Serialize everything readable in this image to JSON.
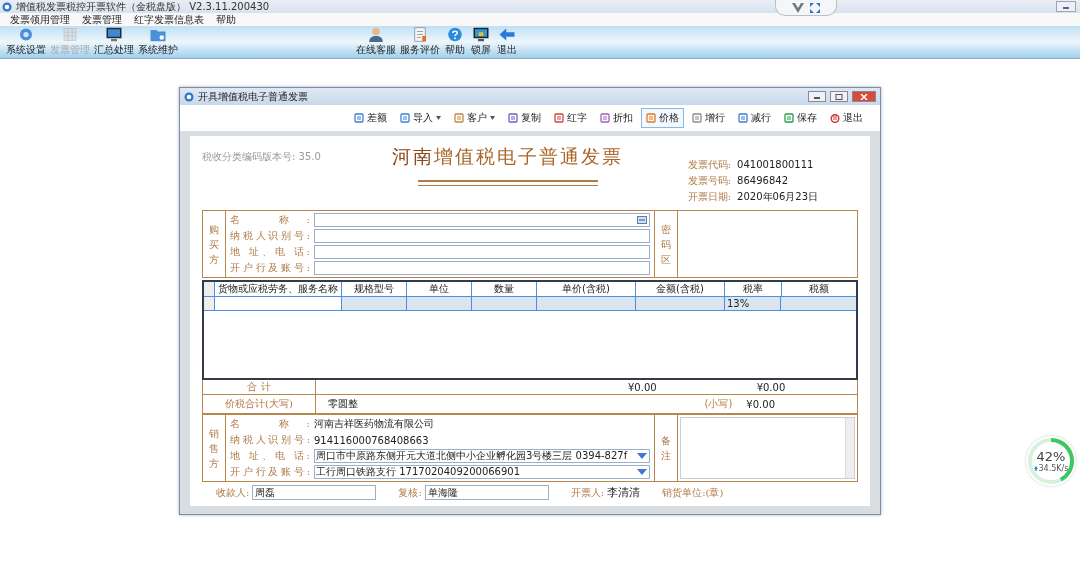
{
  "app": {
    "title": "增值税发票税控开票软件（金税盘版） V2.3.11.200430"
  },
  "menu": [
    "发票领用管理",
    "发票管理",
    "红字发票信息表",
    "帮助"
  ],
  "toolbar_left": [
    {
      "label": "系统设置",
      "disabled": false
    },
    {
      "label": "发票管理",
      "disabled": true
    },
    {
      "label": "汇总处理",
      "disabled": false
    },
    {
      "label": "系统维护",
      "disabled": false
    }
  ],
  "toolbar_right": [
    {
      "label": "在线客服"
    },
    {
      "label": "服务评价"
    },
    {
      "label": "帮助"
    },
    {
      "label": "锁屏"
    },
    {
      "label": "退出"
    }
  ],
  "dialog": {
    "title": "开具增值税电子普通发票",
    "toolbar": [
      {
        "label": "差额",
        "dropdown": false,
        "selected": false
      },
      {
        "label": "导入",
        "dropdown": true,
        "selected": false
      },
      {
        "label": "客户",
        "dropdown": true,
        "selected": false
      },
      {
        "label": "复制",
        "dropdown": false,
        "selected": false
      },
      {
        "label": "红字",
        "dropdown": false,
        "selected": false
      },
      {
        "label": "折扣",
        "dropdown": false,
        "selected": false
      },
      {
        "label": "价格",
        "dropdown": false,
        "selected": true
      },
      {
        "label": "增行",
        "dropdown": false,
        "selected": false
      },
      {
        "label": "减行",
        "dropdown": false,
        "selected": false
      },
      {
        "label": "保存",
        "dropdown": false,
        "selected": false
      },
      {
        "label": "退出",
        "dropdown": false,
        "selected": false
      }
    ]
  },
  "invoice": {
    "version": "税收分类编码版本号: 35.0",
    "title_region": "河南",
    "title": "增值税电子普通发票",
    "meta": [
      {
        "label": "发票代码:",
        "value": "041001800111"
      },
      {
        "label": "发票号码:",
        "value": "86496842"
      },
      {
        "label": "开票日期:",
        "value": "2020年06月23日"
      }
    ],
    "buyer": {
      "side_label": "购买方",
      "password_label": "密码区",
      "fields": [
        {
          "label": "名 称:",
          "kind": "lookup"
        },
        {
          "label": "纳税人识别号:",
          "kind": "text"
        },
        {
          "label": "地 址、电 话:",
          "kind": "text"
        },
        {
          "label": "开户行及账号:",
          "kind": "text"
        }
      ]
    },
    "table": {
      "columns": [
        "货物或应税劳务、服务名称",
        "规格型号",
        "单位",
        "数量",
        "单价(含税)",
        "金额(含税)",
        "税率",
        "税额"
      ],
      "rows": [
        {
          "tax_rate": "13%",
          "selected": true
        }
      ]
    },
    "totals": {
      "label": "合 计",
      "amount": "¥0.00",
      "tax": "¥0.00"
    },
    "grand_total": {
      "label": "价税合计(大写)",
      "in_words": "零圆整",
      "small_label": "(小写)",
      "amount": "¥0.00"
    },
    "seller": {
      "side_label": "销售方",
      "remarks_label": "备注",
      "fields": [
        {
          "label": "名 称:",
          "value": "河南吉祥医药物流有限公司",
          "kind": "text"
        },
        {
          "label": "纳税人识别号:",
          "value": "914116000768408663",
          "kind": "text"
        },
        {
          "label": "地 址、电 话:",
          "value": "周口市中原路东侧开元大道北侧中小企业孵化园3号楼三层 0394-827f",
          "kind": "dropdown"
        },
        {
          "label": "开户行及账号:",
          "value": "工行周口铁路支行 1717020409200066901",
          "kind": "dropdown"
        }
      ]
    },
    "signatures": [
      {
        "label": "收款人:",
        "value": "周磊",
        "kind": "input"
      },
      {
        "label": "复核:",
        "value": "单海隆",
        "kind": "input"
      },
      {
        "label": "开票人:",
        "value": "李清清",
        "kind": "text"
      },
      {
        "label": "销货单位:(章)",
        "kind": "label"
      }
    ]
  },
  "speed_widget": {
    "percent": "42%",
    "level": 0.42,
    "speed": "34.5K/s"
  }
}
